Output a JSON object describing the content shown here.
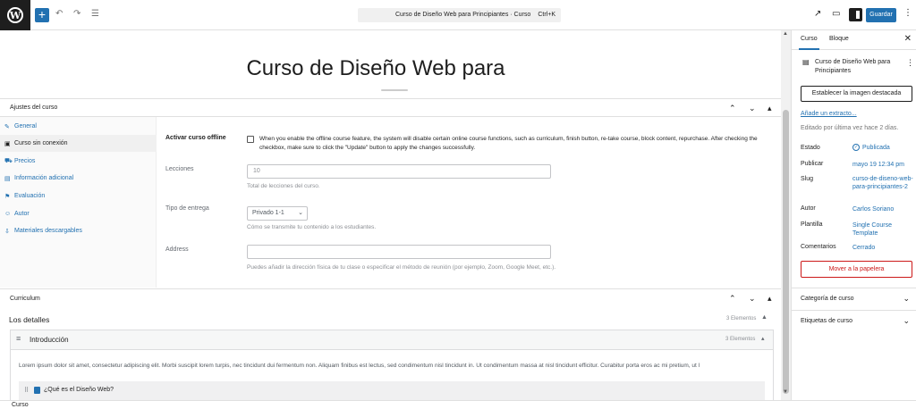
{
  "topbar": {
    "add_icon": "plus-icon",
    "undo_icon": "undo-icon",
    "redo_icon": "redo-icon",
    "list_view_icon": "list-view-icon",
    "command_title": "Curso de Diseño Web para Principiantes · Curso",
    "command_shortcut": "Ctrl+K",
    "save_label": "Guardar",
    "accent": "#2271b1"
  },
  "editor": {
    "post_title": "Curso de Diseño Web para"
  },
  "metabox": {
    "title": "Ajustes del curso",
    "tabs": [
      {
        "label": "General",
        "icon": "wrench-icon"
      },
      {
        "label": "Curso sin conexión",
        "icon": "save-icon"
      },
      {
        "label": "Precios",
        "icon": "cart-icon"
      },
      {
        "label": "Información adicional",
        "icon": "info-icon"
      },
      {
        "label": "Evaluación",
        "icon": "bookmark-icon"
      },
      {
        "label": "Autor",
        "icon": "person-icon"
      },
      {
        "label": "Materiales descargables",
        "icon": "download-icon"
      }
    ],
    "offline_label": "Activar curso offline",
    "offline_desc": "When you enable the offline course feature, the system will disable certain online course functions, such as curriculum, finish button, re-take course, block content, repurchase. After checking the checkbox, make sure to click the \"Update\" button to apply the changes successfully.",
    "lessons_label": "Lecciones",
    "lessons_value": "10",
    "lessons_help": "Total de lecciones del curso.",
    "delivery_label": "Tipo de entrega",
    "delivery_value": "Privado 1-1",
    "delivery_help": "Cómo se transmite tu contenido a los estudiantes.",
    "address_label": "Address",
    "address_value": "",
    "address_help": "Puedes añadir la dirección física de tu clase o especificar el método de reunión (por ejemplo, Zoom, Google Meet, etc.)."
  },
  "curriculum": {
    "title": "Curriculum",
    "details_title": "Los detalles",
    "details_count": "3 Elementos",
    "section_name": "Introducción",
    "section_count": "3 Elementos",
    "section_desc": "Lorem ipsum dolor sit amet, consectetur adipiscing elit. Morbi suscipit lorem turpis, nec tincidunt dui fermentum non. Aliquam finibus est lectus, sed condimentum nisl tincidunt in. Ut condimentum massa at nisl tincidunt efficitur. Curabitur porta eros ac mi pretium, ut l",
    "lesson_title": "¿Qué es el Diseño Web?"
  },
  "footer": {
    "breadcrumb": "Curso"
  },
  "sidebar": {
    "tab_course": "Curso",
    "tab_block": "Bloque",
    "course_title": "Curso de Diseño Web para Principiantes",
    "featured_image_btn": "Establecer la imagen destacada",
    "excerpt_link": "Añade un extracto...",
    "last_edited": "Editado por última vez hace 2 días.",
    "status_label": "Estado",
    "status_value": "Publicada",
    "publish_label": "Publicar",
    "publish_value": "mayo 19 12:34 pm",
    "slug_label": "Slug",
    "slug_value": "curso-de-diseno-web-para-principiantes-2",
    "author_label": "Autor",
    "author_value": "Carlos Soriano",
    "template_label": "Plantilla",
    "template_value": "Single Course Template",
    "comments_label": "Comentarios",
    "comments_value": "Cerrado",
    "trash_btn": "Mover a la papelera",
    "category_panel": "Categoría de curso",
    "tags_panel": "Etiquetas de curso",
    "danger_color": "#cc1818"
  }
}
